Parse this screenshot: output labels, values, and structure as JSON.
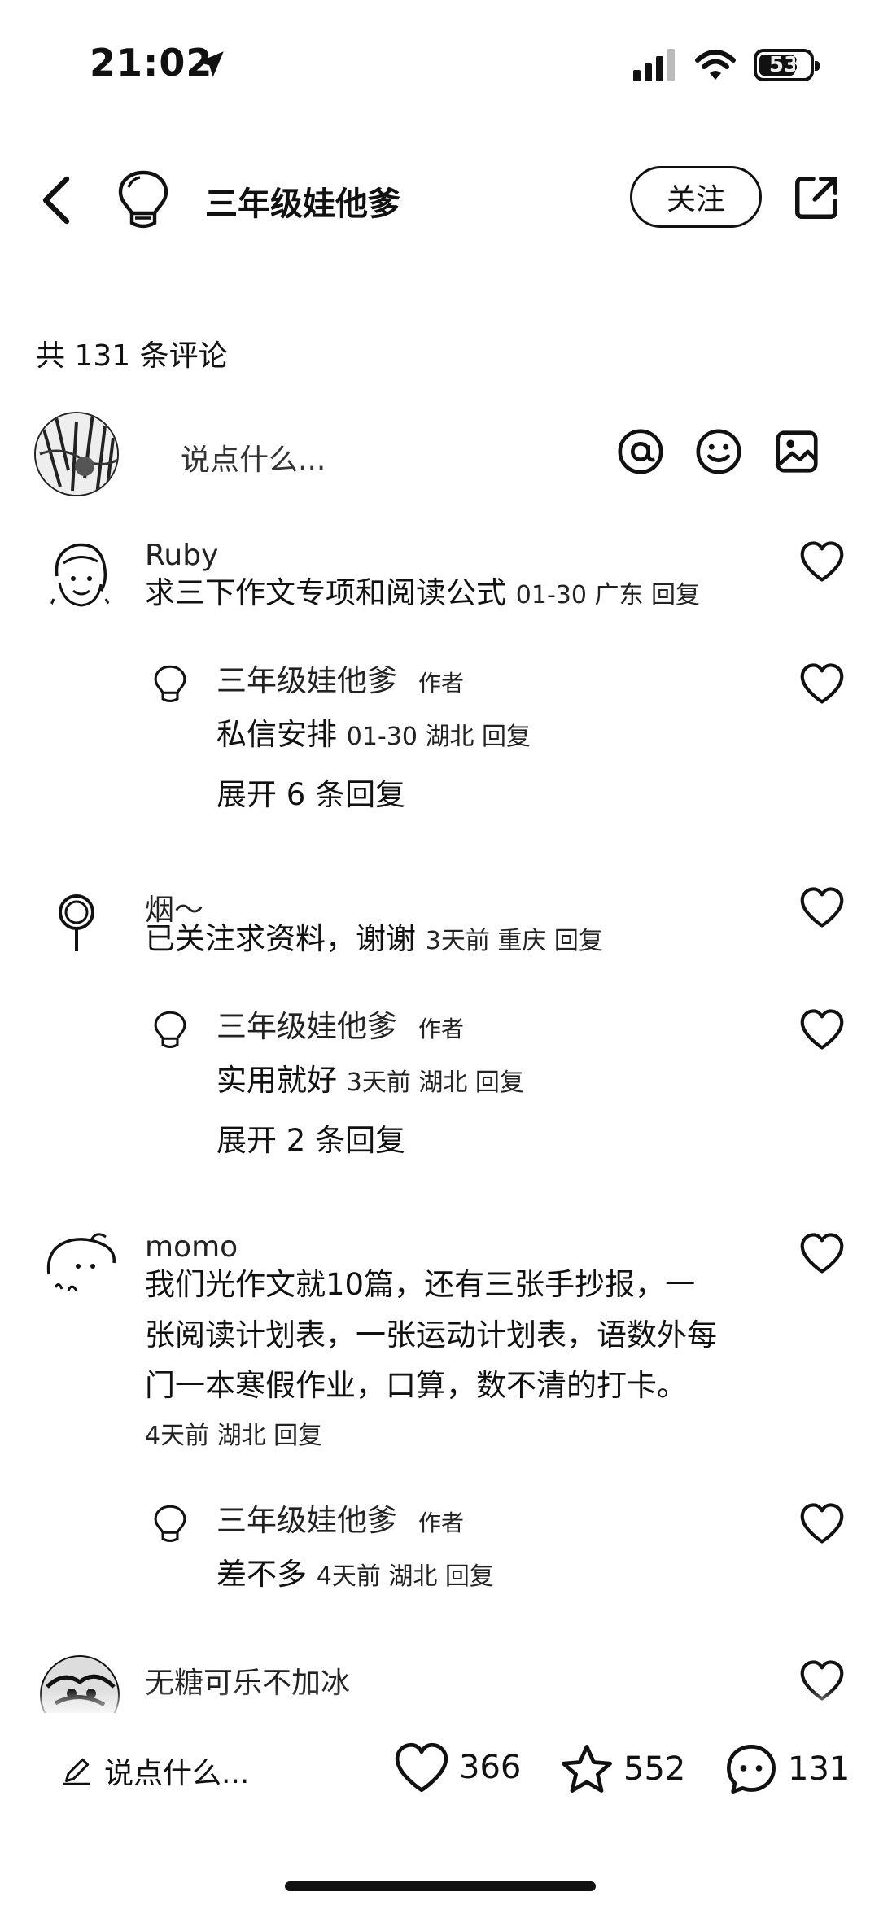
{
  "status_bar": {
    "time": "21:02",
    "battery": "53"
  },
  "header": {
    "author": "三年级娃他爹",
    "follow_label": "关注"
  },
  "comments_header": {
    "count_text": "共 131 条评论"
  },
  "input": {
    "placeholder": "说点什么..."
  },
  "comments": [
    {
      "name": "Ruby",
      "text": "求三下作文专项和阅读公式",
      "meta": "01-30 广东 回复",
      "reply": {
        "name": "三年级娃他爹",
        "tag": "作者",
        "text": "私信安排",
        "meta": "01-30 湖北 回复"
      },
      "expand": "展开 6 条回复"
    },
    {
      "name": "烟～",
      "text": "已关注求资料，谢谢",
      "meta": "3天前 重庆 回复",
      "reply": {
        "name": "三年级娃他爹",
        "tag": "作者",
        "text": "实用就好",
        "meta": "3天前 湖北 回复"
      },
      "expand": "展开 2 条回复"
    },
    {
      "name": "momo",
      "lines": [
        "我们光作文就10篇，还有三张手抄报，一",
        "张阅读计划表，一张运动计划表，语数外每",
        "门一本寒假作业，口算，数不清的打卡。"
      ],
      "meta": "4天前 湖北 回复",
      "reply": {
        "name": "三年级娃他爹",
        "tag": "作者",
        "text": "差不多",
        "meta": "4天前 湖北 回复"
      }
    },
    {
      "name": "无糖可乐不加冰"
    }
  ],
  "bottom_bar": {
    "placeholder": "说点什么...",
    "likes": "366",
    "favorites": "552",
    "comments": "131"
  }
}
